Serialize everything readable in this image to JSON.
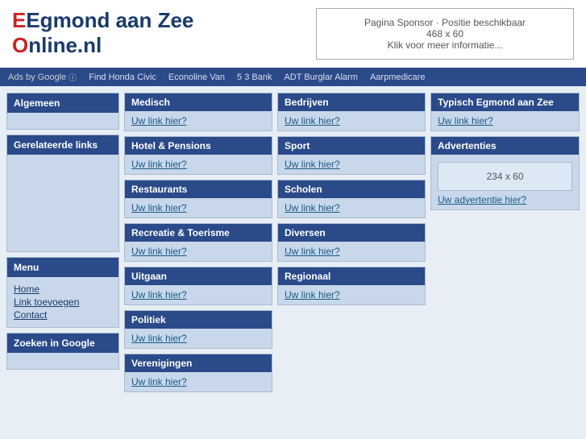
{
  "header": {
    "logo_line1": "Egmond aan Zee",
    "logo_line2": "Online.nl",
    "logo_e": "E",
    "logo_o": "O",
    "sponsor_line1": "Pagina Sponsor · Positie beschikbaar",
    "sponsor_line2": "468 x 60",
    "sponsor_line3": "Klik voor meer informatie..."
  },
  "adbar": {
    "ads_label": "Ads by Google",
    "links": [
      "Find Honda Civic",
      "Econoline Van",
      "5 3 Bank",
      "ADT Burglar Alarm",
      "Aarpmedicare"
    ]
  },
  "sidebar": {
    "algemeen": "Algemeen",
    "gerelateerde": "Gerelateerde links",
    "menu_title": "Menu",
    "menu_items": [
      "Home",
      "Link toevoegen",
      "Contact"
    ],
    "zoeken": "Zoeken in Google"
  },
  "categories": [
    {
      "id": "medisch",
      "title": "Medisch",
      "link": "Uw link hier?",
      "col": "left"
    },
    {
      "id": "bedrijven",
      "title": "Bedrijven",
      "link": "Uw link hier?",
      "col": "right"
    },
    {
      "id": "hotel",
      "title": "Hotel & Pensions",
      "link": "Uw link hier?",
      "col": "left"
    },
    {
      "id": "sport",
      "title": "Sport",
      "link": "Uw link hier?",
      "col": "right"
    },
    {
      "id": "restaurants",
      "title": "Restaurants",
      "link": "Uw link hier?",
      "col": "left"
    },
    {
      "id": "scholen",
      "title": "Scholen",
      "link": "Uw link hier?",
      "col": "right"
    },
    {
      "id": "recreatie",
      "title": "Recreatie & Toerisme",
      "link": "Uw link hier?",
      "col": "left"
    },
    {
      "id": "diversen",
      "title": "Diversen",
      "link": "Uw link hier?",
      "col": "right"
    },
    {
      "id": "uitgaan",
      "title": "Uitgaan",
      "link": "Uw link hier?",
      "col": "left"
    },
    {
      "id": "regionaal",
      "title": "Regionaal",
      "link": "Uw link hier?",
      "col": "right"
    },
    {
      "id": "politiek",
      "title": "Politiek",
      "link": "Uw link hier?",
      "col": "left"
    },
    {
      "id": "verenigingen",
      "title": "Verenigingen",
      "link": "Uw link hier?",
      "col": "left"
    }
  ],
  "right": {
    "typisch_title": "Typisch Egmond aan Zee",
    "typisch_link": "Uw link hier?",
    "advertenties_title": "Advertenties",
    "ad_size": "234 x 60",
    "ad_link": "Uw advertentie hier?"
  }
}
